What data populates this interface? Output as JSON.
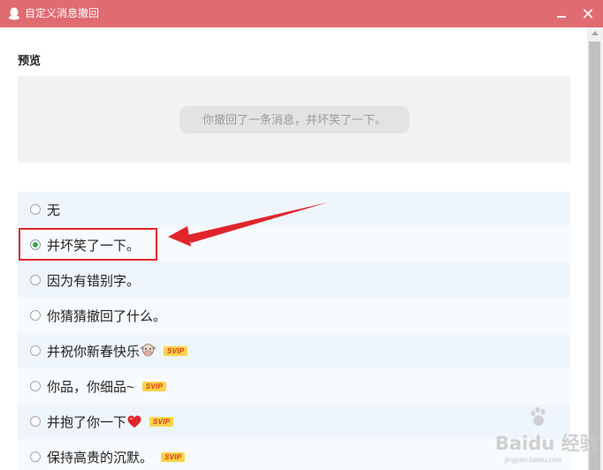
{
  "window": {
    "title": "自定义消息撤回"
  },
  "preview": {
    "label": "预览",
    "bubble_text": "你撤回了一条消息，并坏笑了一下。"
  },
  "options": [
    {
      "label": "无",
      "selected": false,
      "svip": ""
    },
    {
      "label": "并坏笑了一下。",
      "selected": true,
      "svip": ""
    },
    {
      "label": "因为有错别字。",
      "selected": false,
      "svip": ""
    },
    {
      "label": "你猜猜撤回了什么。",
      "selected": false,
      "svip": ""
    },
    {
      "label": "并祝你新春快乐",
      "selected": false,
      "svip": "SVIP",
      "emoji": "cow-face-icon"
    },
    {
      "label": "你品，你细品~",
      "selected": false,
      "svip": "SVIP"
    },
    {
      "label": "并抱了你一下",
      "selected": false,
      "svip": "SVIP",
      "emoji": "red-heart-icon"
    },
    {
      "label": "保持高贵的沉默。",
      "selected": false,
      "svip": "SVIP"
    }
  ],
  "watermark": {
    "text": "Baidu 经验",
    "url": "jingyan.baidu.com"
  },
  "colors": {
    "titlebar": "#e06b71",
    "radio_selected": "#41a244",
    "highlight": "#e0252b",
    "svip_bg": "#fbd34a"
  }
}
